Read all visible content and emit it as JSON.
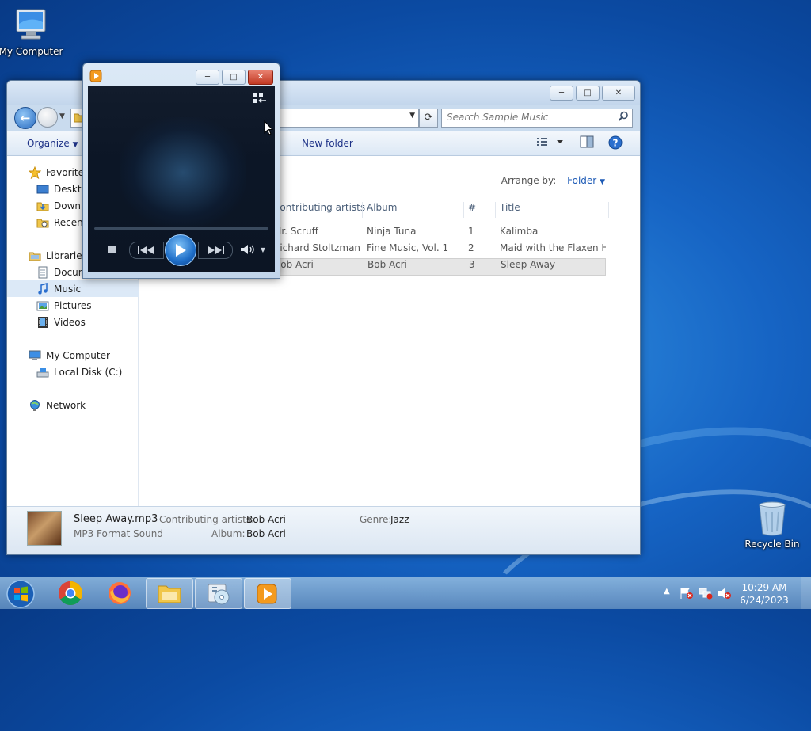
{
  "desktop": {
    "icons": [
      {
        "label": "My Computer"
      },
      {
        "label": "Recycle Bin"
      }
    ]
  },
  "explorer": {
    "search_placeholder": "Search Sample Music",
    "toolbar": {
      "organize": "Organize",
      "new_folder": "New folder"
    },
    "nav": {
      "favorites": "Favorites",
      "desktop": "Desktop",
      "downloads": "Downloads",
      "recent": "Recent Places",
      "libraries": "Libraries",
      "documents": "Documents",
      "music": "Music",
      "pictures": "Pictures",
      "videos": "Videos",
      "my_computer": "My Computer",
      "local_disk": "Local Disk (C:)",
      "network": "Network"
    },
    "arrange_label": "Arrange by:",
    "arrange_value": "Folder",
    "columns": [
      "Contributing artists",
      "Album",
      "#",
      "Title"
    ],
    "rows": [
      {
        "artist": "Mr. Scruff",
        "album": "Ninja Tuna",
        "num": "1",
        "title": "Kalimba"
      },
      {
        "artist": "Richard Stoltzman...",
        "album": "Fine Music, Vol. 1",
        "num": "2",
        "title": "Maid with the Flaxen H..."
      },
      {
        "artist": "Bob Acri",
        "album": "Bob Acri",
        "num": "3",
        "title": "Sleep Away"
      }
    ],
    "details": {
      "filename": "Sleep Away.mp3",
      "type": "MP3 Format Sound",
      "artists_label": "Contributing artists:",
      "artists_value": "Bob Acri",
      "album_label": "Album:",
      "album_value": "Bob Acri",
      "genre_label": "Genre:",
      "genre_value": "Jazz"
    }
  },
  "taskbar": {
    "clock_time": "10:29 AM",
    "clock_date": "6/24/2023",
    "pinned": [
      "chrome-icon",
      "firefox-icon",
      "explorer-icon",
      "media-center-icon",
      "media-player-icon"
    ]
  },
  "colors": {
    "accent": "#1e5bb6",
    "selection": "#dce9f7"
  }
}
